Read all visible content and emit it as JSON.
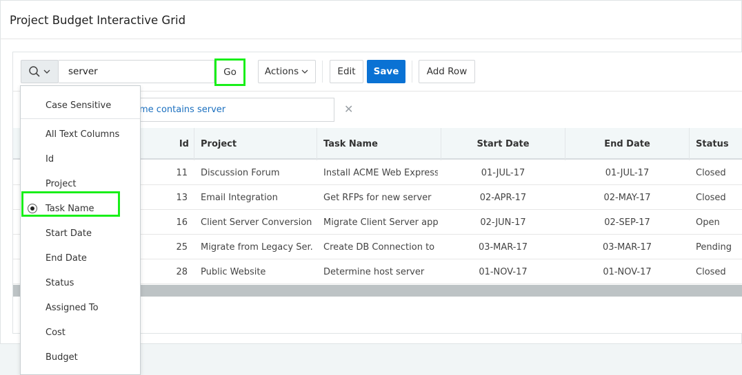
{
  "region": {
    "title": "Project Budget Interactive Grid"
  },
  "toolbar": {
    "search_value": "server",
    "go_label": "Go",
    "actions_label": "Actions",
    "edit_label": "Edit",
    "save_label": "Save",
    "add_row_label": "Add Row"
  },
  "filter": {
    "text": "me contains server",
    "remove_glyph": "✕"
  },
  "columns": [
    "Id",
    "Project",
    "Task Name",
    "Start Date",
    "End Date",
    "Status"
  ],
  "rows": [
    [
      "11",
      "Discussion Forum",
      "Install ACME Web Express...",
      "01-JUL-17",
      "01-JUL-17",
      "Closed"
    ],
    [
      "13",
      "Email Integration",
      "Get RFPs for new server",
      "02-APR-17",
      "02-MAY-17",
      "Closed"
    ],
    [
      "16",
      "Client Server Conversion",
      "Migrate Client Server app...",
      "02-JUN-17",
      "02-SEP-17",
      "Open"
    ],
    [
      "25",
      "Migrate from Legacy Ser...",
      "Create DB Connection to ...",
      "03-MAR-17",
      "03-MAR-17",
      "Pending"
    ],
    [
      "28",
      "Public Website",
      "Determine host server",
      "01-NOV-17",
      "01-NOV-17",
      "Closed"
    ]
  ],
  "dropdown": {
    "case_sensitive": "Case Sensitive",
    "items": [
      "All Text Columns",
      "Id",
      "Project",
      "Task Name",
      "Start Date",
      "End Date",
      "Status",
      "Assigned To",
      "Cost",
      "Budget"
    ],
    "selected": "Task Name"
  },
  "colors": {
    "save_button": "#0a72d4",
    "highlight": "#19ef19",
    "link": "#1a6fbf"
  }
}
